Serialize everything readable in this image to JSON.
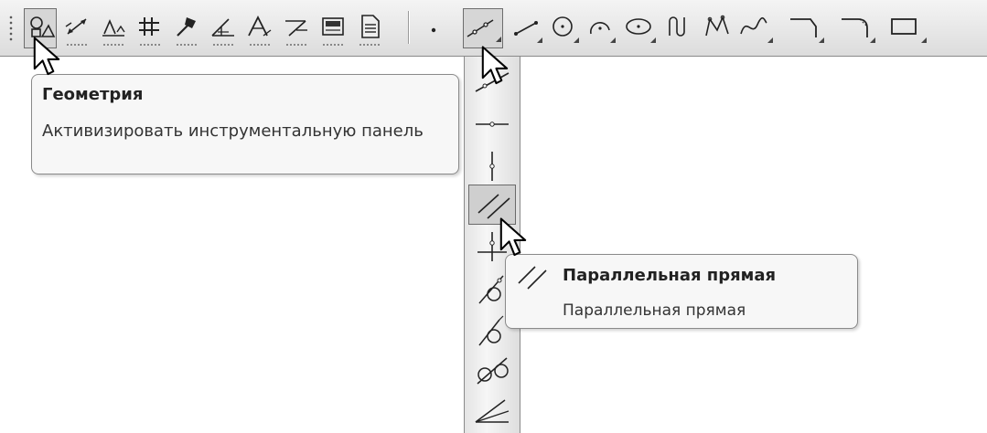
{
  "toolbar": {
    "left_buttons": [
      {
        "icon": "geometry-icon",
        "pressed": true
      },
      {
        "icon": "dimensions-icon"
      },
      {
        "icon": "designations-icon"
      },
      {
        "icon": "edit-icon"
      },
      {
        "icon": "parametrization-icon"
      },
      {
        "icon": "measure-icon"
      },
      {
        "icon": "selection-icon"
      },
      {
        "icon": "associative-views-icon"
      },
      {
        "icon": "spec-icon"
      },
      {
        "icon": "reports-icon"
      }
    ],
    "right_buttons": [
      {
        "icon": "point-icon"
      },
      {
        "icon": "auxiliary-line-icon",
        "pressed": true
      },
      {
        "icon": "segment-icon"
      },
      {
        "icon": "circle-icon"
      },
      {
        "icon": "arc-icon"
      },
      {
        "icon": "ellipse-icon"
      },
      {
        "icon": "continuous-input-icon"
      },
      {
        "icon": "polyline-icon"
      },
      {
        "icon": "bezier-curve-icon"
      },
      {
        "icon": "chamfer-icon"
      },
      {
        "icon": "fillet-icon"
      },
      {
        "icon": "rectangle-icon"
      }
    ]
  },
  "flyout": {
    "items": [
      {
        "icon": "auxiliary-line-two-points-icon"
      },
      {
        "icon": "horizontal-line-icon"
      },
      {
        "icon": "vertical-line-icon"
      },
      {
        "icon": "parallel-line-icon",
        "pressed": true
      },
      {
        "icon": "perpendicular-line-icon"
      },
      {
        "icon": "tangent-line-point-icon"
      },
      {
        "icon": "tangent-line-parallel-icon"
      },
      {
        "icon": "tangent-two-curves-icon"
      },
      {
        "icon": "bisector-icon"
      }
    ]
  },
  "tooltip_geometry": {
    "title": "Геометрия",
    "description": "Активизировать инструментальную панель"
  },
  "tooltip_parallel": {
    "icon": "parallel-line-icon",
    "title": "Параллельная прямая",
    "description": "Параллельная прямая"
  }
}
